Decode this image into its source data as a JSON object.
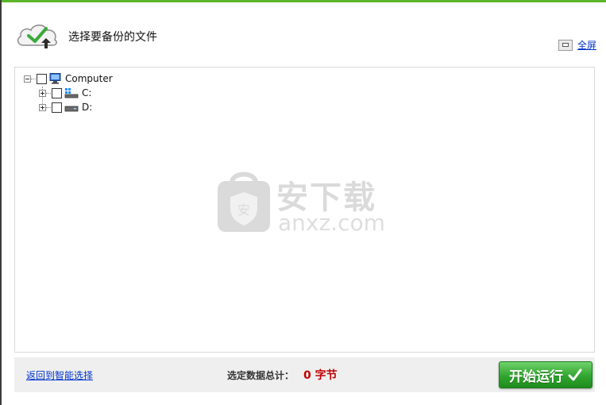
{
  "header": {
    "title": "选择要备份的文件",
    "fullscreen_label": "全屏"
  },
  "tree": {
    "root": {
      "label": "Computer",
      "checked": false,
      "expanded": true,
      "icon": "computer-icon"
    },
    "children": [
      {
        "label": "C:",
        "checked": false,
        "expanded": false,
        "icon": "system-drive-icon"
      },
      {
        "label": "D:",
        "checked": false,
        "expanded": false,
        "icon": "drive-icon"
      }
    ]
  },
  "watermark": {
    "main": "安下载",
    "sub": "anxz.com"
  },
  "footer": {
    "back_link": "返回到智能选择",
    "total_label": "选定数据总计：",
    "total_value": "0 字节",
    "start_button": "开始运行"
  },
  "colors": {
    "accent": "#5ab52b",
    "button_green": "#31a52f",
    "total_red": "#c00000",
    "link_blue": "#0033cc"
  }
}
